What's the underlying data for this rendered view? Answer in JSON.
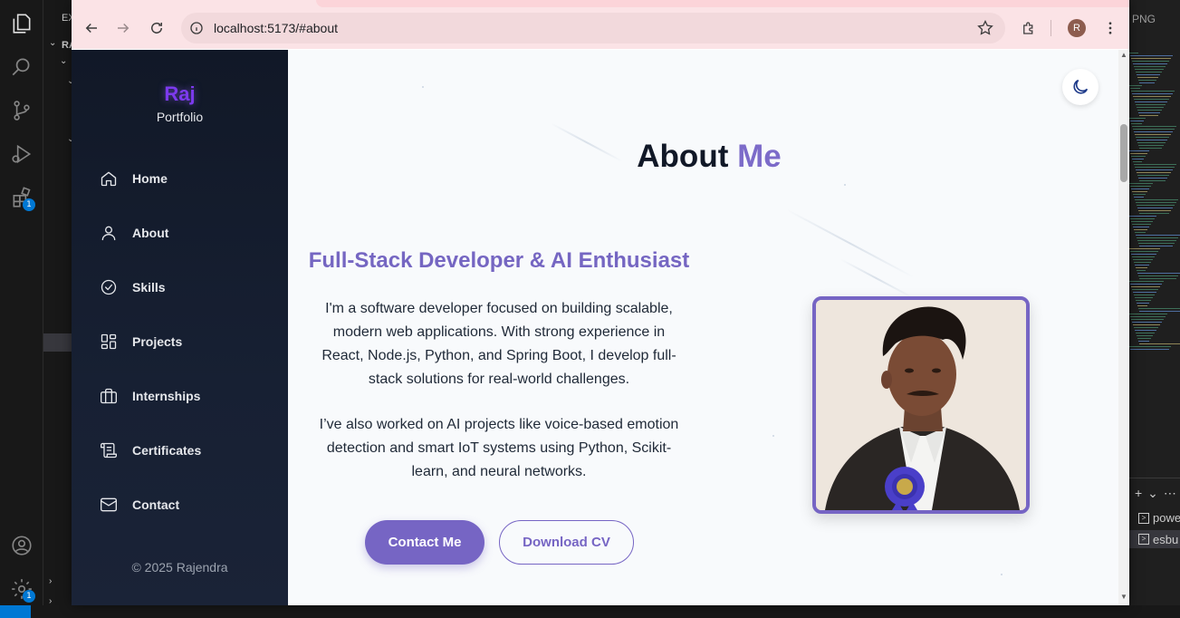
{
  "editor": {
    "explorer_label": "EX",
    "root_label": "RA",
    "right_tab": "PNG",
    "terminals": [
      "powe",
      "esbu"
    ],
    "badges": {
      "extensions": "1",
      "settings": "1"
    }
  },
  "browser": {
    "url": "localhost:5173/#about",
    "profile_initial": "R"
  },
  "sidebar": {
    "brand": "Raj",
    "brand_sub": "Portfolio",
    "items": [
      {
        "label": "Home",
        "icon": "home-icon"
      },
      {
        "label": "About",
        "icon": "user-icon"
      },
      {
        "label": "Skills",
        "icon": "badge-check-icon"
      },
      {
        "label": "Projects",
        "icon": "grid-icon"
      },
      {
        "label": "Internships",
        "icon": "briefcase-icon"
      },
      {
        "label": "Certificates",
        "icon": "scroll-icon"
      },
      {
        "label": "Contact",
        "icon": "mail-icon"
      }
    ],
    "copyright": "© 2025 Rajendra"
  },
  "about": {
    "title_main": "About",
    "title_accent": "Me",
    "subheading": "Full-Stack Developer & AI Enthusiast",
    "paragraph1": "I'm a software developer focused on building scalable, modern web applications. With strong experience in React, Node.js, Python, and Spring Boot, I develop full-stack solutions for real-world challenges.",
    "paragraph2": "I’ve also worked on AI projects like voice-based emotion detection and smart IoT systems using Python, Scikit-learn, and neural networks.",
    "contact_button": "Contact Me",
    "download_button": "Download CV",
    "theme_icon": "moon-icon"
  },
  "colors": {
    "accent": "#7665c4",
    "brand": "#7c3aed",
    "sidebar_bg": "#111827"
  }
}
